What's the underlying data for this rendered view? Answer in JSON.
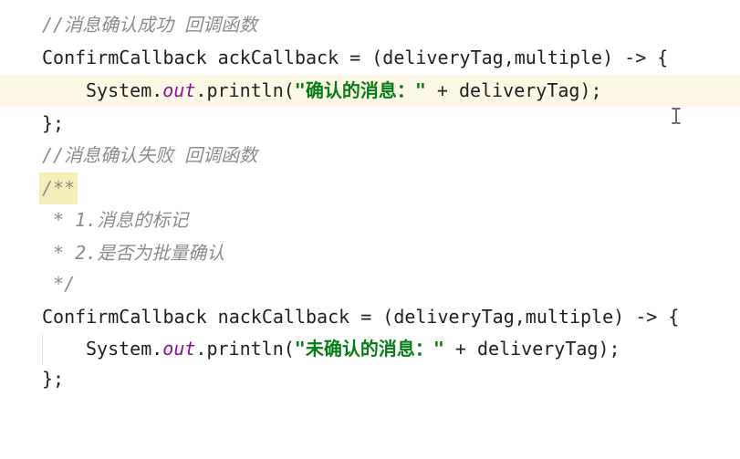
{
  "lines": [
    "//消息确认成功 回调函数",
    "ConfirmCallback ackCallback = (deliveryTag,multiple) -> {",
    {
      "pre": "System.",
      "field": "out",
      "mid": ".println(",
      "str": "\"确认的消息：\"",
      "post": " + deliveryTag);"
    },
    "};",
    "//消息确认失败 回调函数",
    "/**",
    " * 1.消息的标记",
    " * 2.是否为批量确认",
    " */",
    "ConfirmCallback nackCallback = (deliveryTag,multiple) -> {",
    {
      "pre": "System.",
      "field": "out",
      "mid": ".println(",
      "str": "\"未确认的消息：\"",
      "post": " + deliveryTag);"
    },
    "};"
  ],
  "colors": {
    "comment": "#8c8c8c",
    "string": "#067d17",
    "static_field": "#871094",
    "current_line": "#fdf8e6",
    "doc_highlight": "#f6eeb8"
  },
  "icons": {
    "text_cursor": "i-beam-cursor-icon"
  }
}
